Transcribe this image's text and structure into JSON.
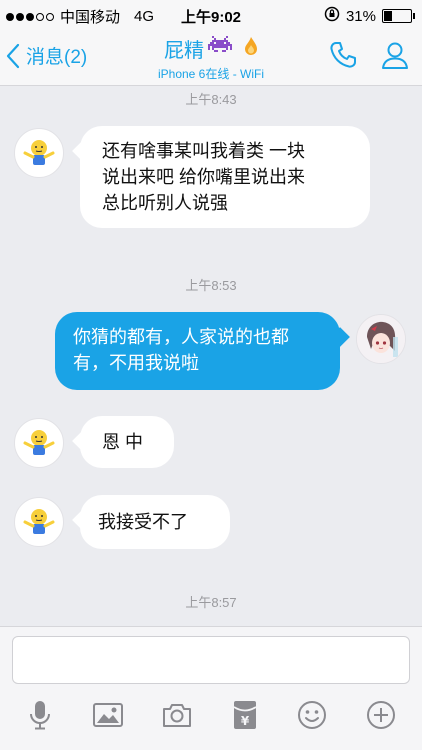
{
  "status_bar": {
    "carrier": "中国移动",
    "network": "4G",
    "time": "上午9:02",
    "battery": "31%",
    "battery_level": 0.31
  },
  "nav": {
    "back_label": "消息(2)",
    "title": "屁精",
    "subtitle": "iPhone 6在线 - WiFi"
  },
  "chat": {
    "timestamps": [
      "上午8:43",
      "上午8:53",
      "上午8:57"
    ],
    "messages": [
      {
        "side": "in",
        "text_lines": [
          "还有啥事某叫我着类 一块",
          "说出来吧 给你嘴里说出来",
          "总比听别人说强"
        ]
      },
      {
        "side": "out",
        "text_lines": [
          "你猜的都有，人家说的也都",
          "有，不用我说啦"
        ]
      },
      {
        "side": "in",
        "text_lines": [
          "恩 中"
        ]
      },
      {
        "side": "in",
        "text_lines": [
          "我接受不了"
        ]
      }
    ]
  },
  "input": {
    "placeholder": ""
  },
  "toolbar": {
    "items": [
      "mic-icon",
      "image-icon",
      "camera-icon",
      "red-packet-icon",
      "emoji-icon",
      "plus-icon"
    ]
  },
  "colors": {
    "accent": "#1aa3e6",
    "chat_bg": "#ebecf0",
    "bubble_in": "#ffffff",
    "bubble_out": "#1aa3e6"
  }
}
